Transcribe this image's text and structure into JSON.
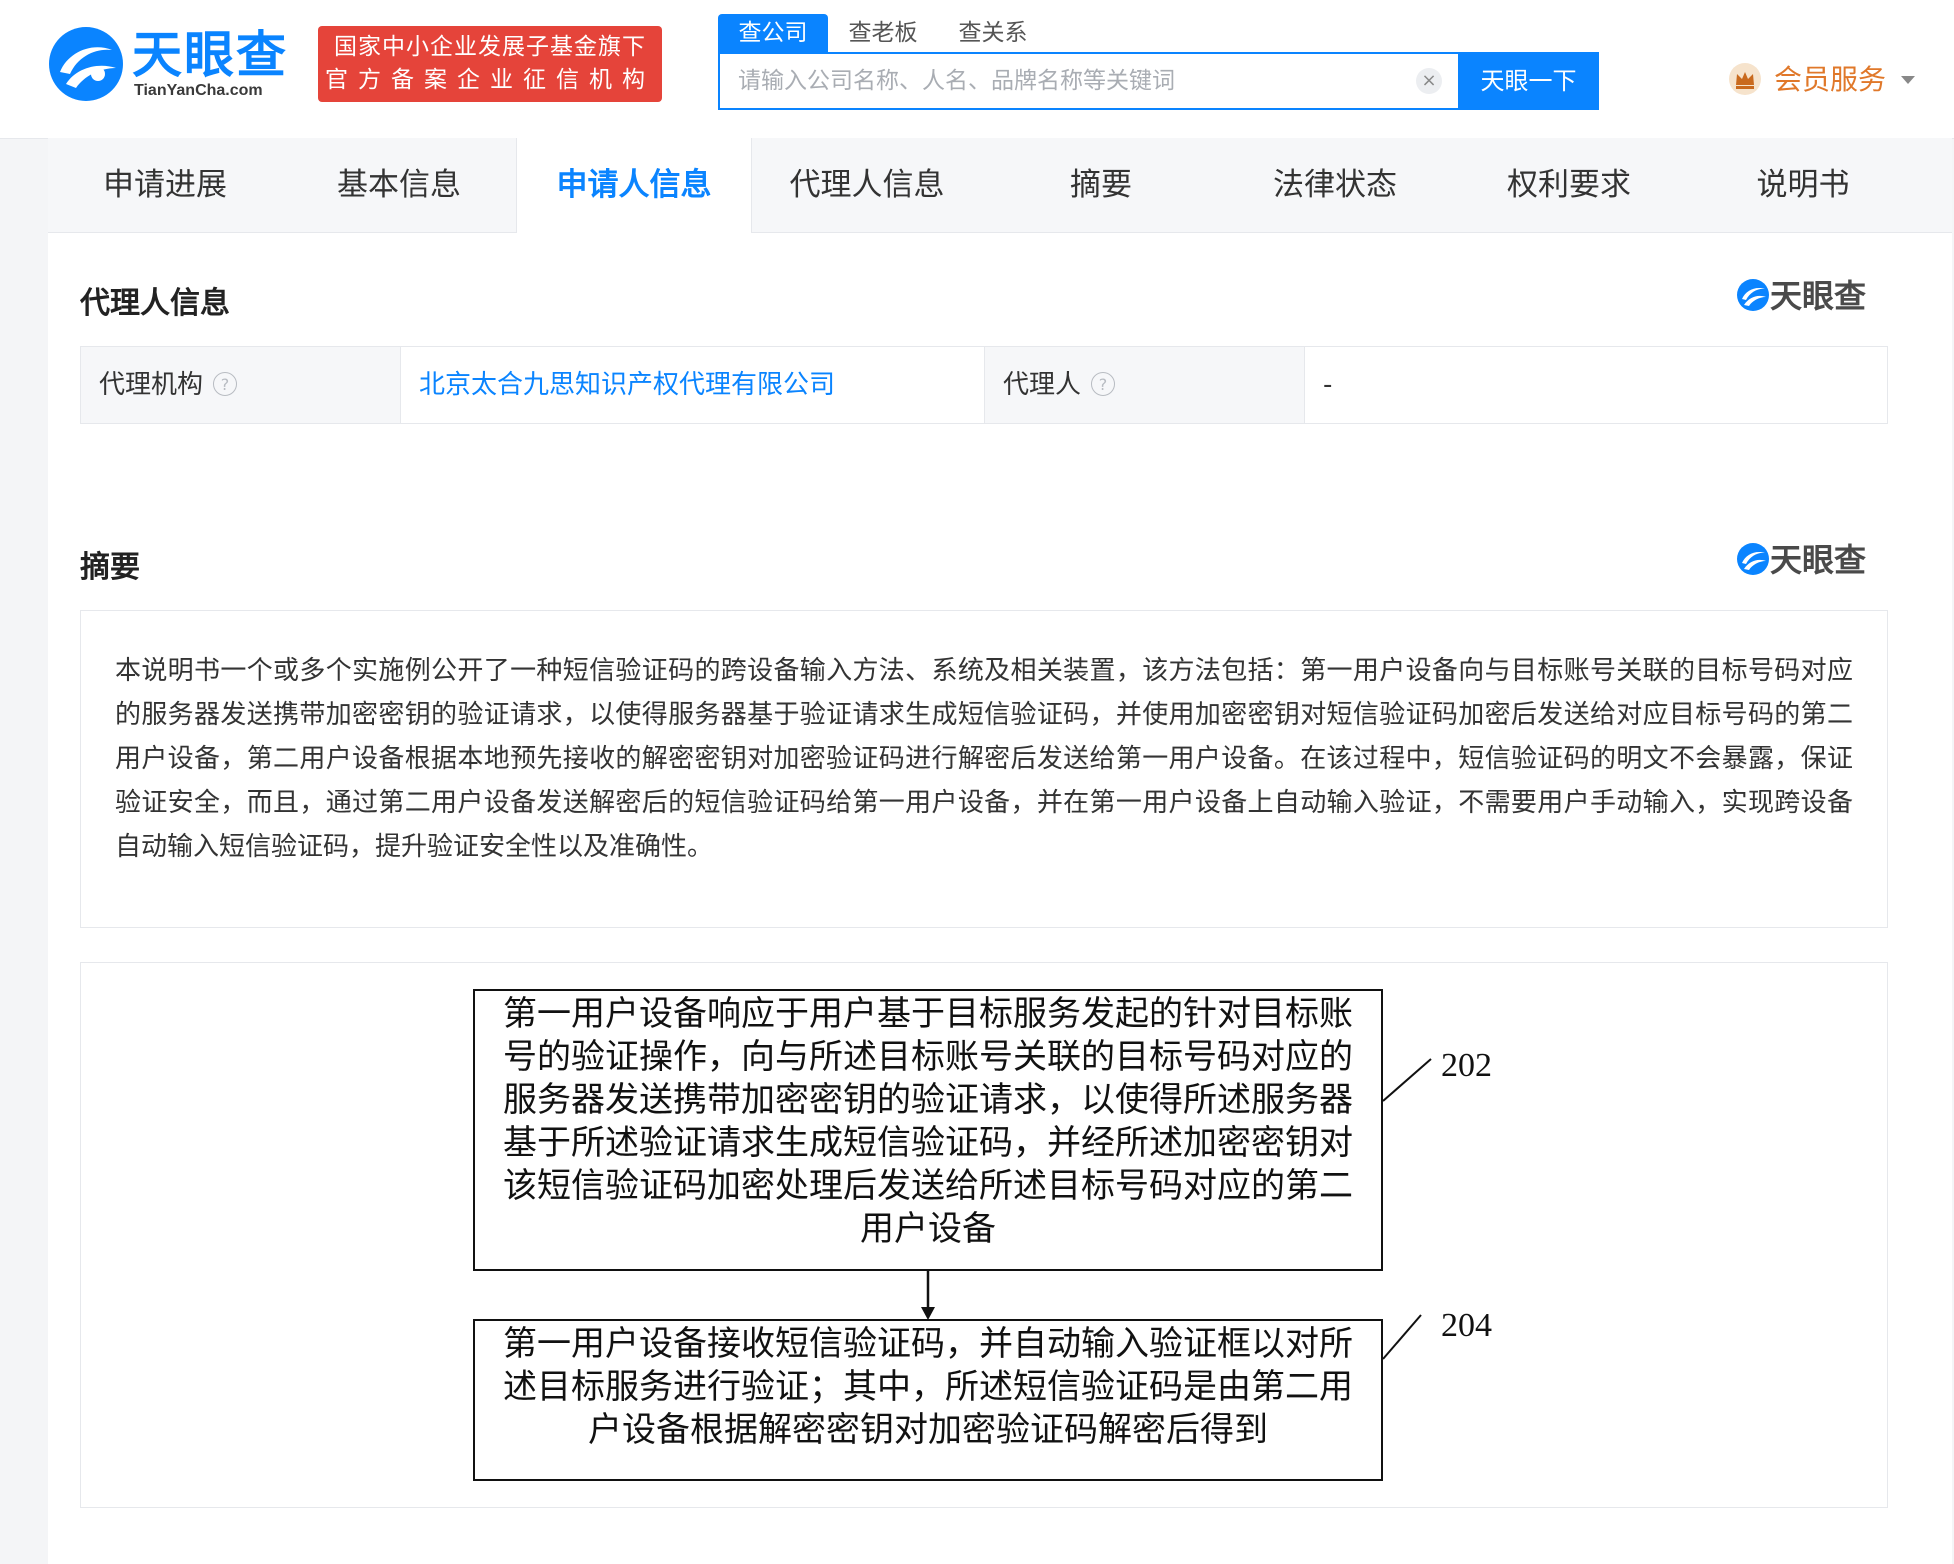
{
  "header": {
    "logo": {
      "cn": "天眼查",
      "en": "TianYanCha.com"
    },
    "badge": {
      "line1": "国家中小企业发展子基金旗下",
      "line2": "官方备案企业征信机构"
    },
    "search": {
      "tabs": [
        {
          "label": "查公司",
          "active": true
        },
        {
          "label": "查老板",
          "active": false
        },
        {
          "label": "查关系",
          "active": false
        }
      ],
      "placeholder": "请输入公司名称、人名、品牌名称等关键词",
      "button_label": "天眼一下"
    },
    "member": {
      "label": "会员服务"
    }
  },
  "tabs": [
    {
      "label": "申请进展",
      "active": false
    },
    {
      "label": "基本信息",
      "active": false
    },
    {
      "label": "申请人信息",
      "active": true
    },
    {
      "label": "代理人信息",
      "active": false
    },
    {
      "label": "摘要",
      "active": false
    },
    {
      "label": "法律状态",
      "active": false
    },
    {
      "label": "权利要求",
      "active": false
    },
    {
      "label": "说明书",
      "active": false
    }
  ],
  "agent_section": {
    "title": "代理人信息",
    "watermark": "天眼查",
    "agency_label": "代理机构",
    "agency_value": "北京太合九思知识产权代理有限公司",
    "agent_label": "代理人",
    "agent_value": "-"
  },
  "abstract_section": {
    "title": "摘要",
    "watermark": "天眼查",
    "text": "本说明书一个或多个实施例公开了一种短信验证码的跨设备输入方法、系统及相关装置，该方法包括：第一用户设备向与目标账号关联的目标号码对应的服务器发送携带加密密钥的验证请求，以使得服务器基于验证请求生成短信验证码，并使用加密密钥对短信验证码加密后发送给对应目标号码的第二用户设备，第二用户设备根据本地预先接收的解密密钥对加密验证码进行解密后发送给第一用户设备。在该过程中，短信验证码的明文不会暴露，保证验证安全，而且，通过第二用户设备发送解密后的短信验证码给第一用户设备，并在第一用户设备上自动输入验证，不需要用户手动输入，实现跨设备自动输入短信验证码，提升验证安全性以及准确性。"
  },
  "figure": {
    "steps": [
      {
        "lines": [
          "第一用户设备响应于用户基于目标服务发起的针对目标账",
          "号的验证操作，向与所述目标账号关联的目标号码对应的",
          "服务器发送携带加密密钥的验证请求，以使得所述服务器",
          "基于所述验证请求生成短信验证码，并经所述加密密钥对",
          "该短信验证码加密处理后发送给所述目标号码对应的第二",
          "用户设备"
        ],
        "label": "202"
      },
      {
        "lines": [
          "第一用户设备接收短信验证码，并自动输入验证框以对所",
          "述目标服务进行验证；其中，所述短信验证码是由第二用",
          "户设备根据解密密钥对加密验证码解密后得到"
        ],
        "label": "204"
      }
    ]
  },
  "colors": {
    "brand": "#0a84ff",
    "badge": "#e5443a",
    "member": "#e0782a"
  }
}
